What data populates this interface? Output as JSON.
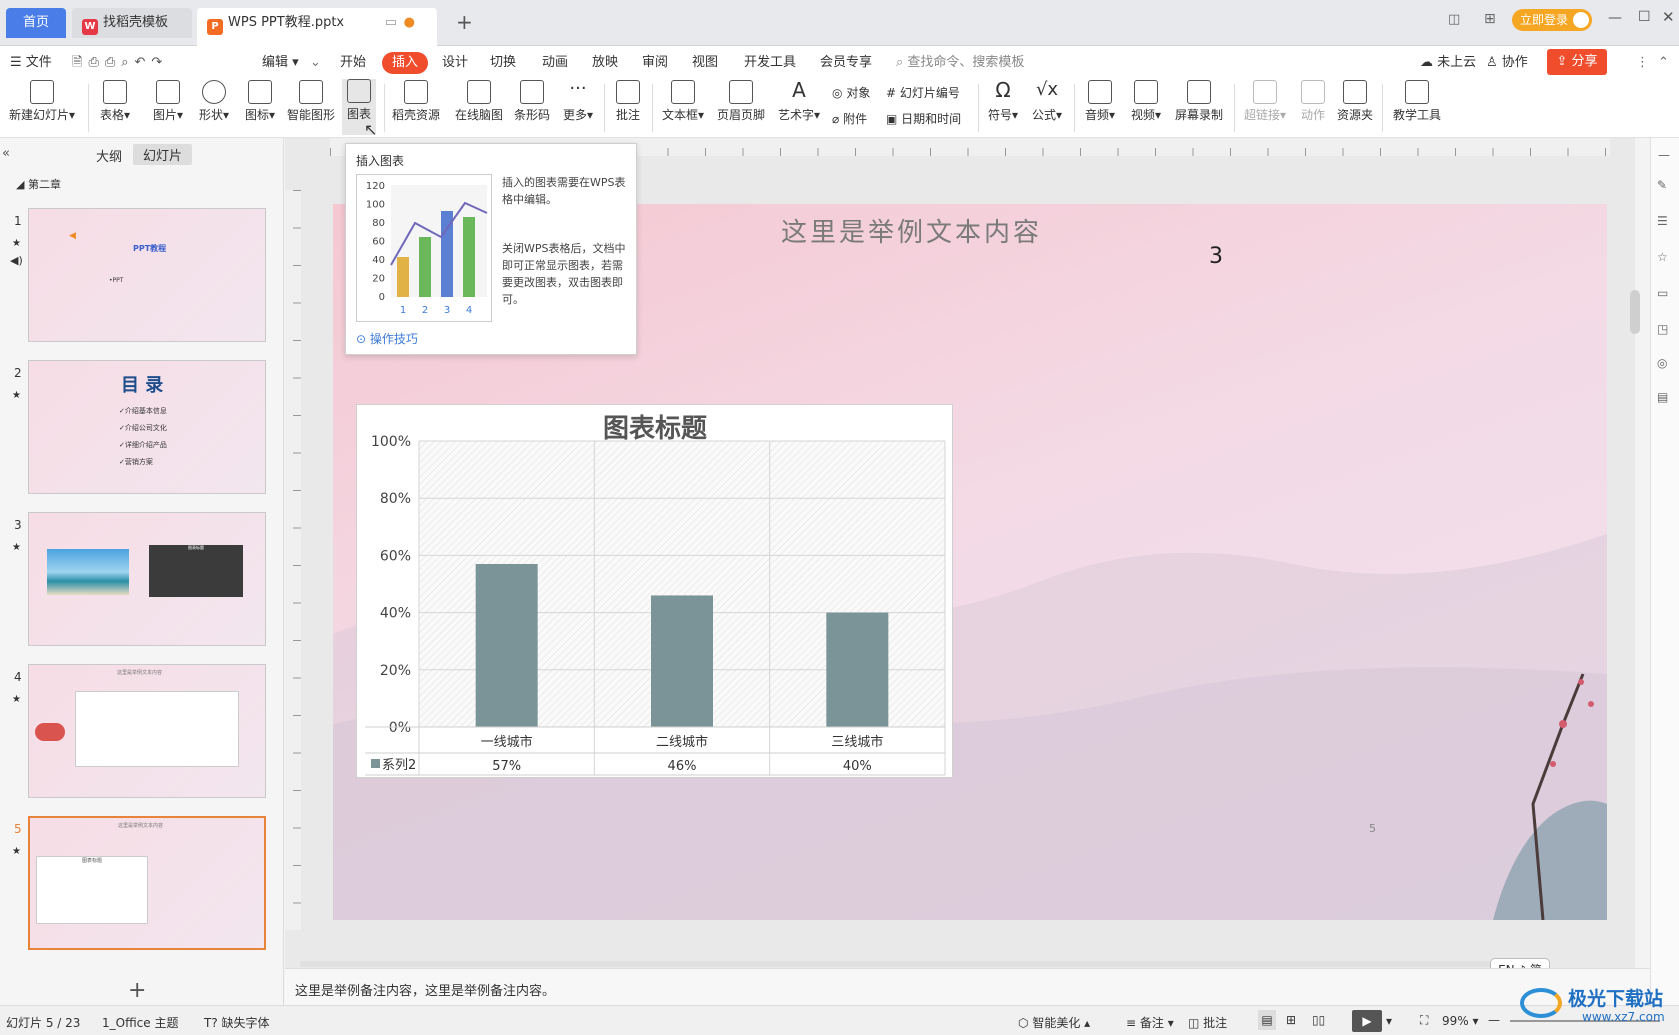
{
  "tabs": {
    "home": "首页",
    "template": "找稻壳模板",
    "doc": "WPS PPT教程.pptx",
    "new": "+"
  },
  "window": {
    "login": "立即登录"
  },
  "menu": {
    "file": "文件",
    "edit": "编辑",
    "items": [
      "开始",
      "插入",
      "设计",
      "切换",
      "动画",
      "放映",
      "审阅",
      "视图",
      "开发工具",
      "会员专享"
    ],
    "search": "查找命令、搜索模板",
    "cloud": "未上云",
    "collab": "协作",
    "share": "分享"
  },
  "ribbon": {
    "new_slide": "新建幻灯片",
    "table": "表格",
    "picture": "图片",
    "shape": "形状",
    "icon": "图标",
    "smartart": "智能图形",
    "chart": "图表",
    "docer": "稻壳资源",
    "mindmap": "在线脑图",
    "barcode": "条形码",
    "more": "更多",
    "comment": "批注",
    "textbox": "文本框",
    "header_footer": "页眉页脚",
    "wordart": "艺术字",
    "object": "对象",
    "slide_no": "幻灯片编号",
    "attach": "附件",
    "datetime": "日期和时间",
    "symbol": "符号",
    "formula": "公式",
    "audio": "音频",
    "video": "视频",
    "screen_rec": "屏幕录制",
    "hyperlink": "超链接",
    "action": "动作",
    "resource": "资源夹",
    "teach": "教学工具"
  },
  "pane": {
    "outline": "大纲",
    "slides": "幻灯片",
    "section": "第二章",
    "numbers": [
      "1",
      "2",
      "3",
      "4",
      "5"
    ],
    "t1_title": "PPT教程",
    "t1_sub": "•PPT",
    "t2_title": "目 录",
    "t2_items": [
      "✓介绍基本信息",
      "✓介绍公司文化",
      "✓详细介绍产品",
      "✓营销方案"
    ],
    "t3_chart": "图表标题",
    "t4_title": "这里是举例文本内容",
    "t5_title": "这里是举例文本内容",
    "t5_chart": "图表标题",
    "add": "+"
  },
  "tooltip": {
    "title": "插入图表",
    "desc1": "插入的图表需要在WPS表格中编辑。",
    "desc2": "关闭WPS表格后，文档中即可正常显示图表，若需要更改图表，双击图表即可。",
    "link": "操作技巧",
    "yticks": [
      "120",
      "100",
      "80",
      "60",
      "40",
      "20",
      "0"
    ],
    "xticks": [
      "1",
      "2",
      "3",
      "4"
    ]
  },
  "slide": {
    "title": "这里是举例文本内容",
    "number": "3",
    "page": "5"
  },
  "chart_data": {
    "type": "bar",
    "title": "图表标题",
    "categories": [
      "一线城市",
      "二线城市",
      "三线城市"
    ],
    "series": [
      {
        "name": "系列2",
        "values": [
          57,
          46,
          40
        ],
        "labels": [
          "57%",
          "46%",
          "40%"
        ]
      }
    ],
    "ylim": [
      0,
      100
    ],
    "yticks": [
      "100%",
      "80%",
      "60%",
      "40%",
      "20%",
      "0%"
    ],
    "color": "#7b9497",
    "data_table": true
  },
  "ime": "EN ♪ 简",
  "notes": "这里是举例备注内容，这里是举例备注内容。",
  "status": {
    "slide": "幻灯片 5 / 23",
    "theme": "1_Office 主题",
    "font": "缺失字体",
    "beautify": "智能美化",
    "notes": "备注",
    "comment": "批注",
    "zoom": "99%"
  },
  "watermark": {
    "name": "极光下载站",
    "url": "www.xz7.com"
  }
}
